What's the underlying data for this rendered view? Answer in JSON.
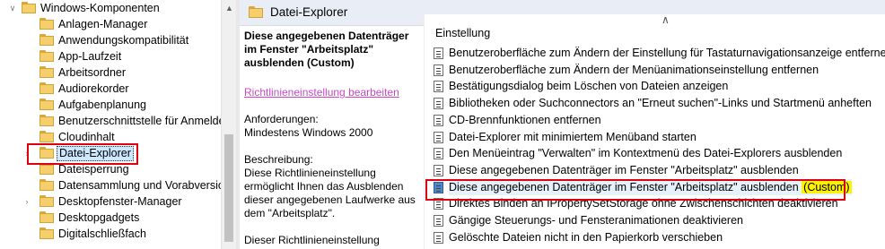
{
  "tree": {
    "root_label": "Windows-Komponenten",
    "items": [
      {
        "label": "Anlagen-Manager",
        "expandable": false
      },
      {
        "label": "Anwendungskompatibilität",
        "expandable": false
      },
      {
        "label": "App-Laufzeit",
        "expandable": false
      },
      {
        "label": "Arbeitsordner",
        "expandable": false
      },
      {
        "label": "Audiorekorder",
        "expandable": false
      },
      {
        "label": "Aufgabenplanung",
        "expandable": false
      },
      {
        "label": "Benutzerschnittstelle für Anmelde",
        "expandable": false
      },
      {
        "label": "Cloudinhalt",
        "expandable": false
      },
      {
        "label": "Datei-Explorer",
        "expandable": true,
        "selected": true
      },
      {
        "label": "Dateisperrung",
        "expandable": false
      },
      {
        "label": "Datensammlung und Vorabversion",
        "expandable": false
      },
      {
        "label": "Desktopfenster-Manager",
        "expandable": true
      },
      {
        "label": "Desktopgadgets",
        "expandable": false
      },
      {
        "label": "Digitalschließfach",
        "expandable": false
      }
    ]
  },
  "header": {
    "title": "Datei-Explorer"
  },
  "description": {
    "title": "Diese angegebenen Datenträger im Fenster \"Arbeitsplatz\" ausblenden (Custom)",
    "edit_link": "Richtlinieneinstellung bearbeiten",
    "requirements_label": "Anforderungen:",
    "requirements_value": "Mindestens Windows 2000",
    "description_label": "Beschreibung:",
    "description_text": "Diese Richtlinieneinstellung ermöglicht Ihnen das Ausblenden dieser angegebenen Laufwerke aus dem \"Arbeitsplatz\".",
    "description_more": "Dieser Richtlinieneinstellung"
  },
  "policy_list": {
    "column_header": "Einstellung",
    "items": [
      {
        "label": "Benutzeroberfläche zum Ändern der Einstellung für Tastaturnavigationsanzeige entfernen"
      },
      {
        "label": "Benutzeroberfläche zum Ändern der Menüanimationseinstellung entfernen"
      },
      {
        "label": "Bestätigungsdialog beim Löschen von Dateien anzeigen"
      },
      {
        "label": "Bibliotheken oder Suchconnectors an \"Erneut suchen\"-Links und Startmenü anheften"
      },
      {
        "label": "CD-Brennfunktionen entfernen"
      },
      {
        "label": "Datei-Explorer mit minimiertem Menüband starten"
      },
      {
        "label": "Den Menüeintrag \"Verwalten\" im Kontextmenü des Datei-Explorers ausblenden"
      },
      {
        "label": "Diese angegebenen Datenträger im Fenster \"Arbeitsplatz\" ausblenden"
      },
      {
        "label": "Diese angegebenen Datenträger im Fenster \"Arbeitsplatz\" ausblenden",
        "suffix": "(Custom)",
        "selected": true
      },
      {
        "label": "Direktes Binden an IPropertySetStorage ohne Zwischenschichten deaktivieren"
      },
      {
        "label": "Gängige Steuerungs- und Fensteranimationen deaktivieren"
      },
      {
        "label": "Gelöschte Dateien nicht in den Papierkorb verschieben"
      }
    ]
  },
  "colors": {
    "highlight_border": "#e0000f",
    "custom_highlight": "#fff200",
    "link": "#c848c8",
    "header_bg": "#e9eef6"
  }
}
